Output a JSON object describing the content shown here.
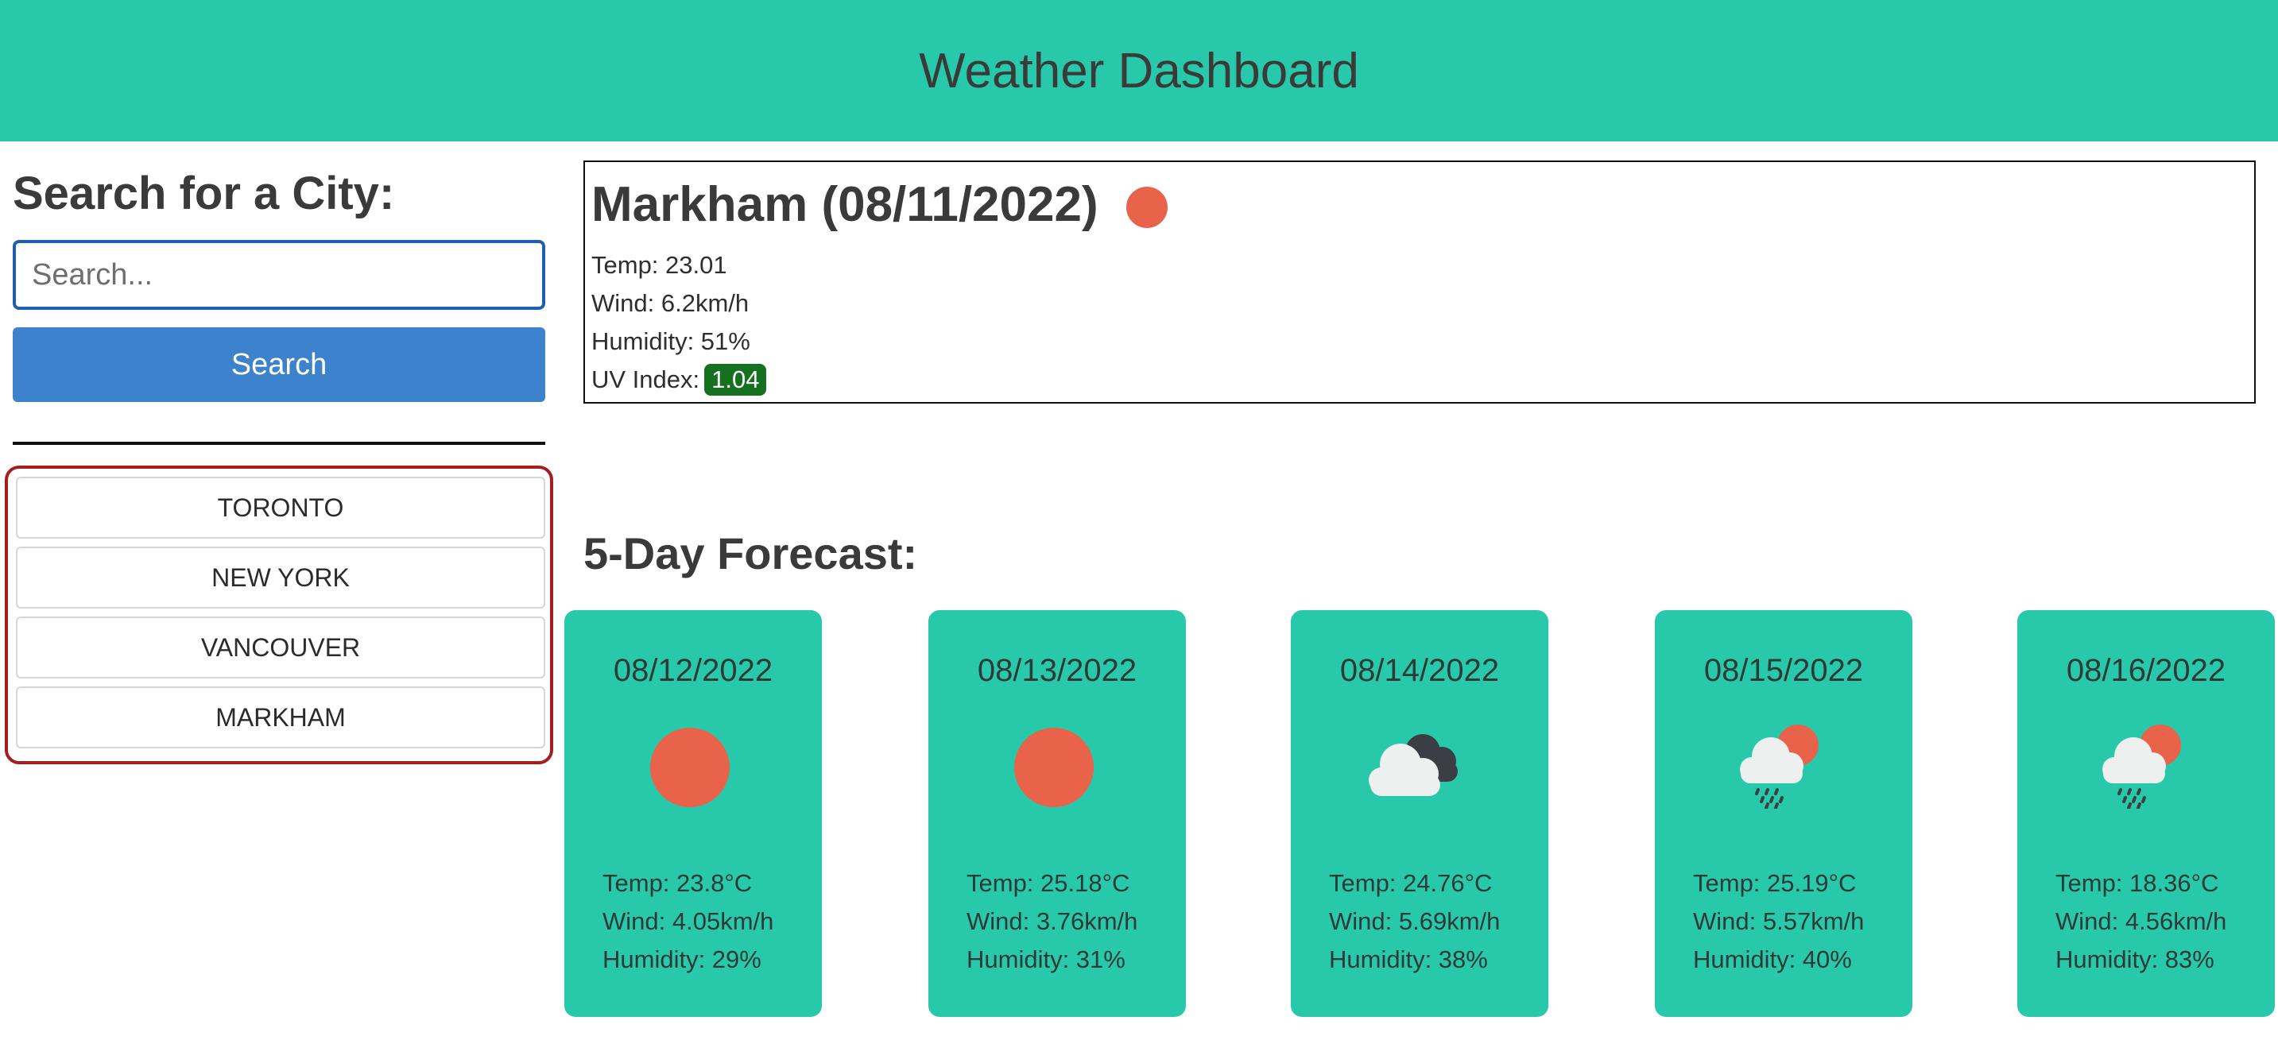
{
  "header": {
    "title": "Weather Dashboard"
  },
  "search": {
    "heading": "Search for a City:",
    "placeholder": "Search...",
    "button_label": "Search"
  },
  "history": [
    "TORONTO",
    "NEW YORK",
    "VANCOUVER",
    "MARKHAM"
  ],
  "current": {
    "title": "Markham (08/11/2022)",
    "icon": "sun-icon",
    "temp": "Temp: 23.01",
    "wind": "Wind: 6.2km/h",
    "humidity": "Humidity: 51%",
    "uv_label": "UV Index:",
    "uv_value": "1.04",
    "uv_color": "#15701f"
  },
  "forecast": {
    "heading": "5-Day Forecast:",
    "days": [
      {
        "date": "08/12/2022",
        "icon": "sun-icon",
        "temp": "Temp: 23.8°C",
        "wind": "Wind: 4.05km/h",
        "humidity": "Humidity: 29%"
      },
      {
        "date": "08/13/2022",
        "icon": "sun-icon",
        "temp": "Temp: 25.18°C",
        "wind": "Wind: 3.76km/h",
        "humidity": "Humidity: 31%"
      },
      {
        "date": "08/14/2022",
        "icon": "broken-clouds-icon",
        "temp": "Temp: 24.76°C",
        "wind": "Wind: 5.69km/h",
        "humidity": "Humidity: 38%"
      },
      {
        "date": "08/15/2022",
        "icon": "rain-sun-icon",
        "temp": "Temp: 25.19°C",
        "wind": "Wind: 5.57km/h",
        "humidity": "Humidity: 40%"
      },
      {
        "date": "08/16/2022",
        "icon": "rain-sun-icon",
        "temp": "Temp: 18.36°C",
        "wind": "Wind: 4.56km/h",
        "humidity": "Humidity: 83%"
      }
    ]
  },
  "colors": {
    "accent": "#27c9aa",
    "search_button": "#3d82cd",
    "history_border": "#a51d1d",
    "sun": "#e8634a"
  }
}
